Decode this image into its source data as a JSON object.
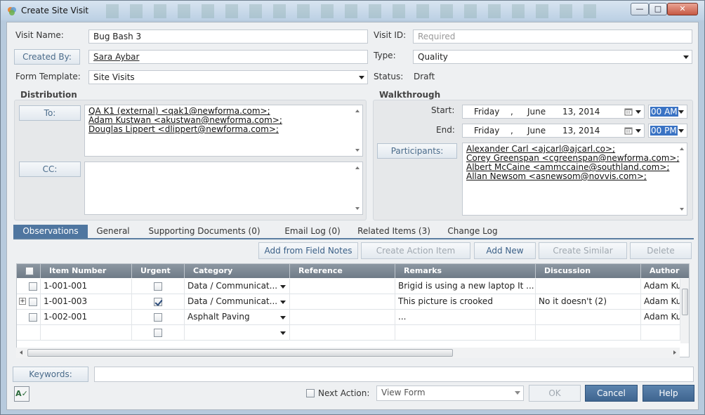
{
  "window": {
    "title": "Create Site Visit",
    "min_glyph": "—",
    "max_glyph": "□",
    "close_glyph": "✕"
  },
  "form": {
    "visit_name_label": "Visit Name:",
    "visit_name_value": "Bug Bash 3",
    "created_by_label": "Created By:",
    "created_by_value": "Sara Aybar",
    "form_template_label": "Form Template:",
    "form_template_value": "Site Visits",
    "visit_id_label": "Visit ID:",
    "visit_id_placeholder": "Required",
    "type_label": "Type:",
    "type_value": "Quality",
    "status_label": "Status:",
    "status_value": "Draft"
  },
  "distribution": {
    "title": "Distribution",
    "to_label": "To:",
    "to_recipients": [
      "QA K1 (external) <qak1@newforma.com>;",
      "Adam Kustwan <akustwan@newforma.com>;",
      "Douglas Lippert <dlippert@newforma.com>;"
    ],
    "cc_label": "CC:"
  },
  "walkthrough": {
    "title": "Walkthrough",
    "start_label": "Start:",
    "end_label": "End:",
    "start": {
      "day": "Friday",
      "sep": ",",
      "month": "June",
      "date": "13, 2014",
      "time": "00 AM"
    },
    "end": {
      "day": "Friday",
      "sep": ",",
      "month": "June",
      "date": "13, 2014",
      "time": "00 PM"
    },
    "participants_label": "Participants:",
    "participants": [
      "Alexander Carl <ajcarl@ajcarl.co>;",
      "Corey Greenspan <cgreenspan@newforma.com>;",
      "Albert McCaine <ammccaine@southland.com>;",
      "Allan Newsom <asnewsom@novvis.com>;"
    ]
  },
  "tabs": [
    {
      "label": "Observations"
    },
    {
      "label": "General"
    },
    {
      "label": "Supporting Documents (0)"
    },
    {
      "label": "Email Log (0)"
    },
    {
      "label": "Related Items (3)"
    },
    {
      "label": "Change Log"
    }
  ],
  "toolbar": {
    "add_from_field_notes": "Add from Field Notes",
    "create_action_item": "Create Action Item",
    "add_new": "Add New",
    "create_similar": "Create Similar",
    "delete": "Delete"
  },
  "grid": {
    "columns": [
      "Item Number",
      "Urgent",
      "Category",
      "Reference",
      "Remarks",
      "Discussion",
      "Author"
    ],
    "rows": [
      {
        "item_number": "1-001-001",
        "urgent": false,
        "category": "Data / Communicat...",
        "reference": "",
        "remarks": "Brigid is using a new laptop It ...",
        "discussion": "",
        "author": "Adam Ku",
        "expand": ""
      },
      {
        "item_number": "1-001-003",
        "urgent": true,
        "category": "Data / Communicat...",
        "reference": "",
        "remarks": "This picture is crooked",
        "discussion": "No it doesn't (2)",
        "author": "Adam Ku",
        "expand": "+"
      },
      {
        "item_number": "1-002-001",
        "urgent": false,
        "category": "Asphalt Paving",
        "reference": "",
        "remarks": "...",
        "discussion": "",
        "author": "Adam Ku",
        "expand": ""
      },
      {
        "item_number": "",
        "urgent": false,
        "category": "",
        "reference": "",
        "remarks": "",
        "discussion": "",
        "author": "",
        "expand": ""
      }
    ]
  },
  "keywords": {
    "label": "Keywords:",
    "value": ""
  },
  "footer": {
    "next_action_label": "Next Action:",
    "next_action_value": "View Form",
    "ok": "OK",
    "cancel": "Cancel",
    "help": "Help",
    "spellcheck_glyph": "A✓"
  },
  "colors": {
    "accent": "#4f76a0",
    "grid_header": "#7a8692",
    "primary_button": "#4a719b"
  }
}
